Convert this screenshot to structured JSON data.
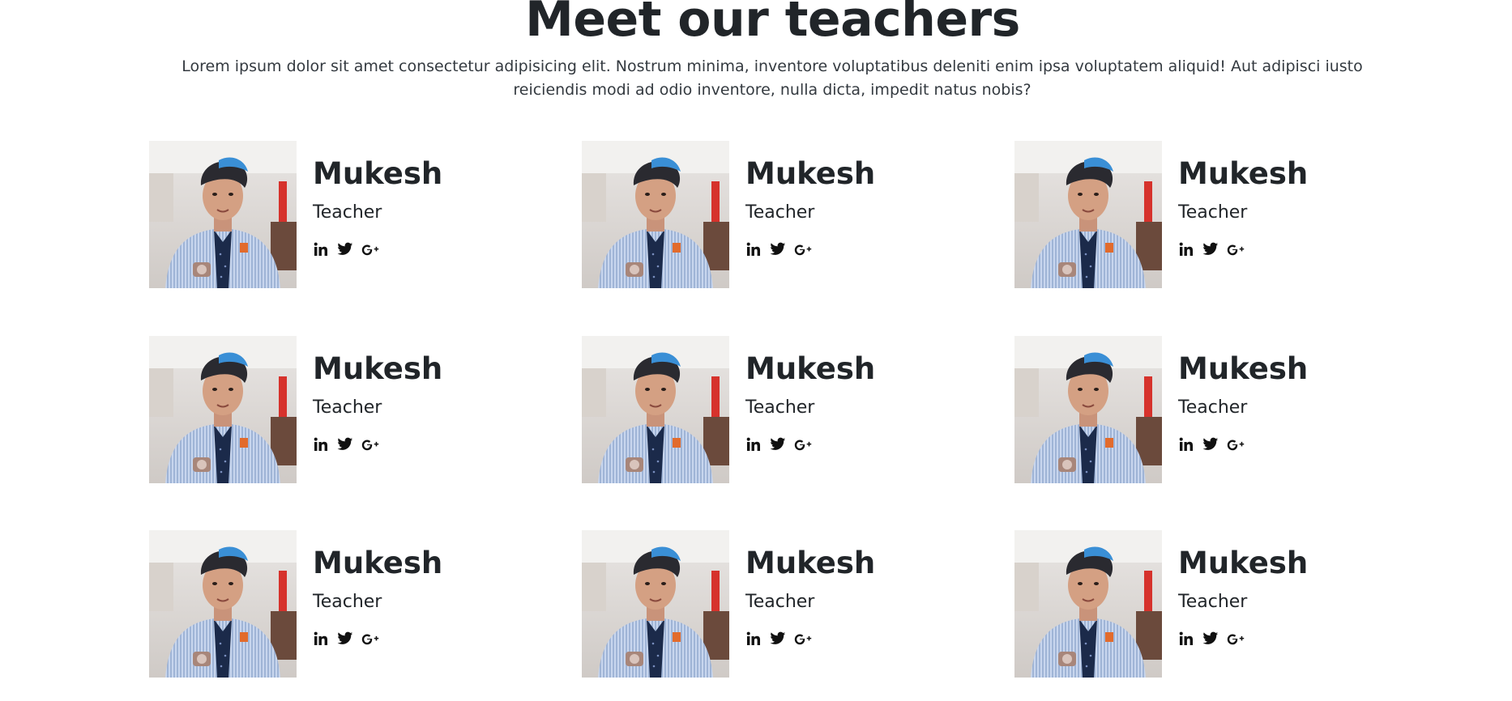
{
  "header": {
    "title": "Meet our teachers",
    "subtitle": "Lorem ipsum dolor sit amet consectetur adipisicing elit. Nostrum minima, inventore voluptatibus deleniti enim ipsa voluptatem aliquid! Aut adipisci iusto reiciendis modi ad odio inventore, nulla dicta, impedit natus nobis?"
  },
  "teachers": [
    {
      "name": "Mukesh",
      "role": "Teacher",
      "socials": [
        "linkedin-icon",
        "twitter-icon",
        "google-plus-icon"
      ]
    },
    {
      "name": "Mukesh",
      "role": "Teacher",
      "socials": [
        "linkedin-icon",
        "twitter-icon",
        "google-plus-icon"
      ]
    },
    {
      "name": "Mukesh",
      "role": "Teacher",
      "socials": [
        "linkedin-icon",
        "twitter-icon",
        "google-plus-icon"
      ]
    },
    {
      "name": "Mukesh",
      "role": "Teacher",
      "socials": [
        "linkedin-icon",
        "twitter-icon",
        "google-plus-icon"
      ]
    },
    {
      "name": "Mukesh",
      "role": "Teacher",
      "socials": [
        "linkedin-icon",
        "twitter-icon",
        "google-plus-icon"
      ]
    },
    {
      "name": "Mukesh",
      "role": "Teacher",
      "socials": [
        "linkedin-icon",
        "twitter-icon",
        "google-plus-icon"
      ]
    },
    {
      "name": "Mukesh",
      "role": "Teacher",
      "socials": [
        "linkedin-icon",
        "twitter-icon",
        "google-plus-icon"
      ]
    },
    {
      "name": "Mukesh",
      "role": "Teacher",
      "socials": [
        "linkedin-icon",
        "twitter-icon",
        "google-plus-icon"
      ]
    },
    {
      "name": "Mukesh",
      "role": "Teacher",
      "socials": [
        "linkedin-icon",
        "twitter-icon",
        "google-plus-icon"
      ]
    }
  ],
  "colors": {
    "text": "#212529",
    "icon": "#111111",
    "background": "#ffffff"
  }
}
